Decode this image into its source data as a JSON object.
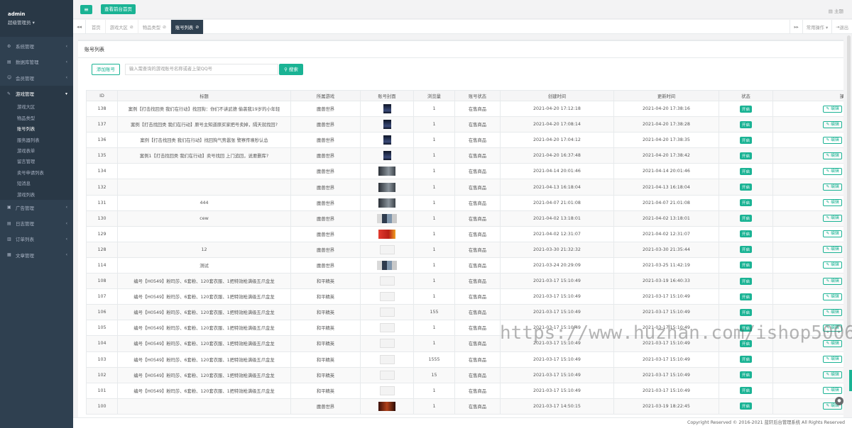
{
  "sidebar": {
    "user": "admin",
    "role": "超级管理员 ▾",
    "menu": [
      {
        "label": "系统管理",
        "icon": "⚙"
      },
      {
        "label": "数据库管理",
        "icon": "▤"
      },
      {
        "label": "会员管理",
        "icon": "☺"
      },
      {
        "label": "游戏管理",
        "icon": "✎"
      }
    ],
    "submenu": [
      "游戏大区",
      "物品类型",
      "账号列表",
      "服务器列表",
      "游戏表单",
      "留言管理",
      "卖号申请列表",
      "短消息",
      "游戏列表"
    ],
    "menu2": [
      {
        "label": "广告管理",
        "icon": "▣"
      },
      {
        "label": "日志管理",
        "icon": "▤"
      },
      {
        "label": "订单列表",
        "icon": "▥"
      },
      {
        "label": "文章管理",
        "icon": "▦"
      }
    ]
  },
  "topbar": {
    "front_label": "查看前台首页",
    "theme_label": "主题"
  },
  "tabs": [
    {
      "label": "首页",
      "close": ""
    },
    {
      "label": "游戏大区",
      "close": "⊘"
    },
    {
      "label": "物品类型",
      "close": "⊘"
    },
    {
      "label": "账号列表",
      "close": "⊘"
    }
  ],
  "tabtools": {
    "ops": "常用操作 ▾",
    "logout": "退出"
  },
  "page": {
    "title": "账号列表",
    "add_label": "添加账号",
    "search_placeholder": "输入需查询的游戏账号名称或者上架QQ号",
    "search_label": "搜索"
  },
  "table": {
    "headers": [
      "ID",
      "标题",
      "所属游戏",
      "账号封面",
      "浏览量",
      "账号状态",
      "创建时间",
      "更新时间",
      "状态",
      "操作"
    ],
    "rows": [
      {
        "id": "138",
        "title": "案例【打击找回类 我们在行动】找回狗：你们不讲武德 偷袭我19岁的小年轻",
        "game": "魔兽世界",
        "cover": "dark",
        "views": "1",
        "status": "在售商品",
        "created": "2021-04-20 17:12:18",
        "updated": "2021-04-20 17:38:16"
      },
      {
        "id": "137",
        "title": "案例【打击找回类 我们在行动】原号主知道原买家把号卖掉，隔天就找回?",
        "game": "魔兽世界",
        "cover": "dark",
        "views": "1",
        "status": "在售商品",
        "created": "2021-04-20 17:08:14",
        "updated": "2021-04-20 17:38:28"
      },
      {
        "id": "136",
        "title": "案例【打击找回类 我们在行动】找回狗气势嚣张 警察传唤秒认怂",
        "game": "魔兽世界",
        "cover": "dark",
        "views": "1",
        "status": "在售商品",
        "created": "2021-04-20 17:04:12",
        "updated": "2021-04-20 17:38:35"
      },
      {
        "id": "135",
        "title": "案例1【打击找回类 我们在行动】卖号找回 上门追回，说要删库?",
        "game": "魔兽世界",
        "cover": "dark",
        "views": "1",
        "status": "在售商品",
        "created": "2021-04-20 16:37:48",
        "updated": "2021-04-20 17:38:42"
      },
      {
        "id": "134",
        "title": "",
        "game": "魔兽世界",
        "cover": "photo",
        "views": "1",
        "status": "在售商品",
        "created": "2021-04-14 20:01:46",
        "updated": "2021-04-14 20:01:46"
      },
      {
        "id": "132",
        "title": "",
        "game": "魔兽世界",
        "cover": "photo",
        "views": "1",
        "status": "在售商品",
        "created": "2021-04-13 16:18:04",
        "updated": "2021-04-13 16:18:04"
      },
      {
        "id": "131",
        "title": "444",
        "game": "魔兽世界",
        "cover": "photo",
        "views": "1",
        "status": "在售商品",
        "created": "2021-04-07 21:01:08",
        "updated": "2021-04-07 21:01:08"
      },
      {
        "id": "130",
        "title": "cew",
        "game": "魔兽世界",
        "cover": "collage",
        "views": "1",
        "status": "在售商品",
        "created": "2021-04-02 13:18:01",
        "updated": "2021-04-02 13:18:01"
      },
      {
        "id": "129",
        "title": "",
        "game": "魔兽世界",
        "cover": "red",
        "views": "1",
        "status": "在售商品",
        "created": "2021-04-02 12:31:07",
        "updated": "2021-04-02 12:31:07"
      },
      {
        "id": "128",
        "title": "12",
        "game": "魔兽世界",
        "cover": "blank",
        "views": "1",
        "status": "在售商品",
        "created": "2021-03-30 21:32:32",
        "updated": "2021-03-30 21:35:44"
      },
      {
        "id": "114",
        "title": "测试",
        "game": "魔兽世界",
        "cover": "collage",
        "views": "1",
        "status": "在售商品",
        "created": "2021-03-24 20:29:09",
        "updated": "2021-03-25 11:42:19"
      },
      {
        "id": "108",
        "title": "编号【H0549】粉玛莎、6套粉、120套衣服、1把特效枪满级五爪金龙",
        "game": "和平精英",
        "cover": "blank",
        "views": "1",
        "status": "在售商品",
        "created": "2021-03-17 15:10:49",
        "updated": "2021-03-19 16:40:33"
      },
      {
        "id": "107",
        "title": "编号【H0549】粉玛莎、6套粉、120套衣服、1把特效枪满级五爪金龙",
        "game": "和平精英",
        "cover": "blank",
        "views": "1",
        "status": "在售商品",
        "created": "2021-03-17 15:10:49",
        "updated": "2021-03-17 15:10:49"
      },
      {
        "id": "106",
        "title": "编号【H0549】粉玛莎、6套粉、120套衣服、1把特效枪满级五爪金龙",
        "game": "和平精英",
        "cover": "blank",
        "views": "155",
        "status": "在售商品",
        "created": "2021-03-17 15:10:49",
        "updated": "2021-03-17 15:10:49"
      },
      {
        "id": "105",
        "title": "编号【H0549】粉玛莎、6套粉、120套衣服、1把特效枪满级五爪金龙",
        "game": "和平精英",
        "cover": "blank",
        "views": "1",
        "status": "在售商品",
        "created": "2021-03-17 15:10:49",
        "updated": "2021-03-17 15:10:49"
      },
      {
        "id": "104",
        "title": "编号【H0549】粉玛莎、6套粉、120套衣服、1把特效枪满级五爪金龙",
        "game": "和平精英",
        "cover": "blank",
        "views": "1",
        "status": "在售商品",
        "created": "2021-03-17 15:10:49",
        "updated": "2021-03-17 15:10:49"
      },
      {
        "id": "103",
        "title": "编号【H0549】粉玛莎、6套粉、120套衣服、1把特效枪满级五爪金龙",
        "game": "和平精英",
        "cover": "blank",
        "views": "1555",
        "status": "在售商品",
        "created": "2021-03-17 15:10:49",
        "updated": "2021-03-17 15:10:49"
      },
      {
        "id": "102",
        "title": "编号【H0549】粉玛莎、6套粉、120套衣服、1把特效枪满级五爪金龙",
        "game": "和平精英",
        "cover": "blank",
        "views": "15",
        "status": "在售商品",
        "created": "2021-03-17 15:10:49",
        "updated": "2021-03-17 15:10:49"
      },
      {
        "id": "101",
        "title": "编号【H0549】粉玛莎、6套粉、120套衣服、1把特效枪满级五爪金龙",
        "game": "和平精英",
        "cover": "blank",
        "views": "1",
        "status": "在售商品",
        "created": "2021-03-17 15:10:49",
        "updated": "2021-03-17 15:10:49"
      },
      {
        "id": "100",
        "title": "",
        "game": "魔兽世界",
        "cover": "fire",
        "views": "1",
        "status": "在售商品",
        "created": "2021-03-17 14:50:15",
        "updated": "2021-03-19 18:22:45"
      }
    ],
    "state_label": "开启",
    "edit_label": "编辑",
    "delete_label": "删除"
  },
  "footer": "Copyright Reserved © 2016-2021 蓝轩后台管理系统 All Rights Reserved",
  "watermark": "https://www.huzhan.com/ishop50065",
  "colors": {
    "accent": "#1ab394",
    "sidebar": "#2f4050",
    "danger": "#ed5565"
  }
}
